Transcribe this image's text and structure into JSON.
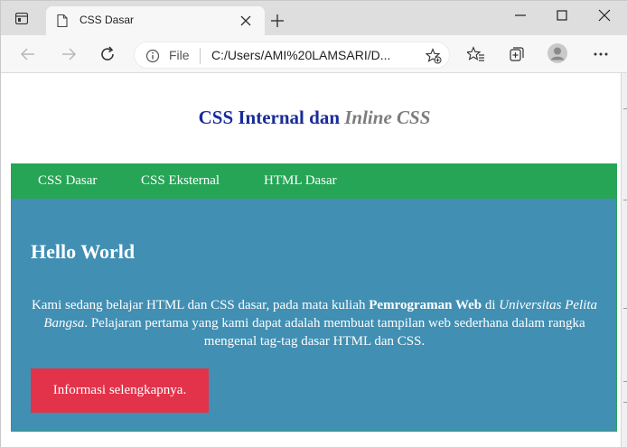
{
  "browser": {
    "tab": {
      "title": "CSS Dasar"
    },
    "address": {
      "scheme_label": "File",
      "url": "C:/Users/AMI%20LAMSARI/D..."
    }
  },
  "page": {
    "heading": {
      "main": "CSS Internal dan ",
      "inline": "Inline CSS"
    },
    "navbar": {
      "links": [
        "CSS Dasar",
        "CSS Eksternal",
        "HTML Dasar"
      ]
    },
    "content": {
      "title": "Hello World",
      "paragraph": {
        "part1": "Kami sedang belajar HTML dan CSS dasar, pada mata kuliah ",
        "bold": "Pemrograman Web",
        "part2": " di ",
        "italic": "Universitas Pelita Bangsa",
        "part3": ". Pelajaran pertama yang kami dapat adalah membuat tampilan web sederhana dalam rangka mengenal tag-tag dasar HTML dan CSS."
      },
      "button_label": "Informasi selengkapnya."
    }
  },
  "colors": {
    "heading_blue": "#1a2c9a",
    "heading_grey": "#7d7d7d",
    "navbar_green": "#27a556",
    "content_blue": "#418fb3",
    "button_red": "#e2334a"
  }
}
